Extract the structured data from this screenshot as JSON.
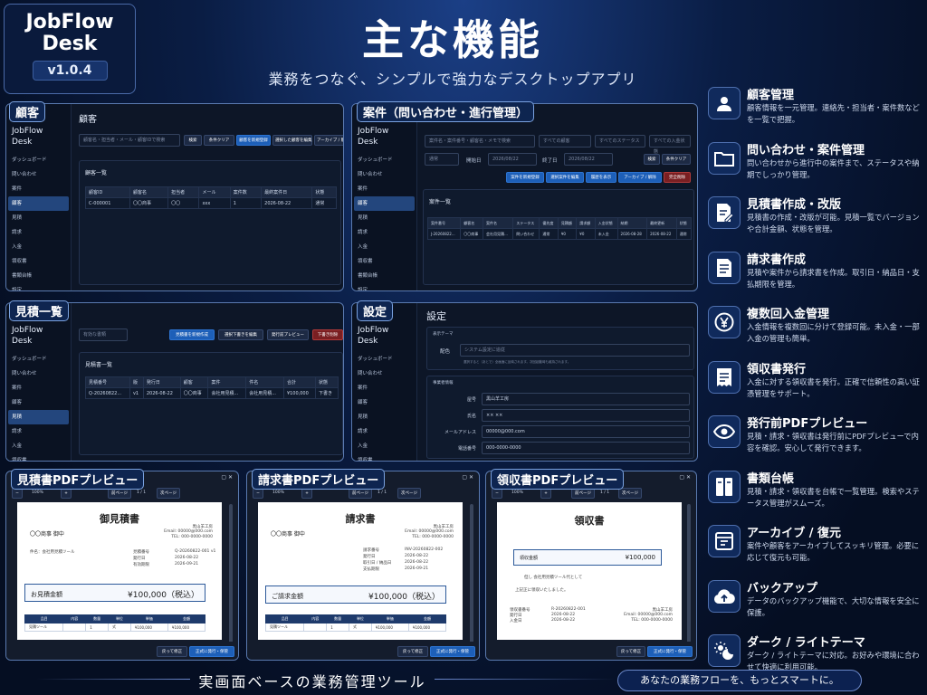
{
  "brand": {
    "name_line1": "JobFlow",
    "name_line2": "Desk",
    "version": "v1.0.4"
  },
  "header": {
    "title": "主な機能",
    "subtitle": "業務をつなぐ、シンプルで強力なデスクトップアプリ"
  },
  "app": {
    "name": "JobFlow Desk"
  },
  "w1": {
    "tag": "顧客",
    "heading": "顧客",
    "search_placeholder": "顧客名・担当者・メール・顧客IDで検索",
    "btns": [
      "検索",
      "条件クリア",
      "顧客を新規登録",
      "選択した顧客を編集",
      "アーカイブ / 削除"
    ],
    "list_title": "顧客一覧",
    "headers": [
      "顧客ID",
      "顧客名",
      "担当者",
      "メール",
      "案件数",
      "最終案件日",
      "状態"
    ],
    "row": [
      "C-000001",
      "〇〇商事",
      "〇〇",
      "xxx",
      "1",
      "2026-08-22",
      "通常"
    ],
    "side": [
      "ダッシュボード",
      "問い合わせ",
      "案件",
      "顧客",
      "見積",
      "請求",
      "入金",
      "領収書",
      "書類台帳",
      "設定"
    ]
  },
  "w2": {
    "tag": "案件（問い合わせ・進行管理）",
    "search_placeholder": "案件名・案件番号・顧客名・メモで検索",
    "selects": [
      "すべての顧客",
      "すべてのステータス",
      "すべての入金状態"
    ],
    "sort": "通常",
    "start_label": "開始日",
    "start_date": "2026/08/22",
    "end_label": "終了日",
    "end_date": "2026/08/22",
    "btn_search": "検索",
    "btn_clear": "条件クリア",
    "btns": [
      "案件を新規登録",
      "選択案件を編集",
      "履歴を表示",
      "アーカイブ / 解除",
      "完全削除"
    ],
    "list_title": "案件一覧",
    "headers": [
      "案件番号",
      "顧客名",
      "案件名",
      "ステータス",
      "優先度",
      "見積額",
      "請求額",
      "入金状態",
      "納期",
      "最終更新",
      "状態"
    ],
    "row": [
      "J-20260822...",
      "〇〇商事",
      "会社用見積...",
      "問い合わせ",
      "通常",
      "¥0",
      "¥0",
      "未入金",
      "2026-08-28",
      "2026-08-22",
      "通常"
    ],
    "side": [
      "ダッシュボード",
      "問い合わせ",
      "案件",
      "顧客",
      "見積",
      "請求",
      "入金",
      "領収書",
      "書類台帳",
      "設定"
    ]
  },
  "w3": {
    "tag": "見積一覧",
    "filter": "有効な書類",
    "btns": [
      "見積書を新規作成",
      "選択下書きを編集",
      "発行前プレビュー",
      "下書き削除"
    ],
    "list_title": "見積書一覧",
    "headers": [
      "見積番号",
      "版",
      "発行日",
      "顧客",
      "案件",
      "件名",
      "合計",
      "状態"
    ],
    "row": [
      "Q-20260822...",
      "v1",
      "2026-08-22",
      "〇〇商事",
      "会社用見積...",
      "会社用見積...",
      "¥100,000",
      "下書き"
    ],
    "side": [
      "ダッシュボード",
      "問い合わせ",
      "案件",
      "顧客",
      "見積",
      "請求",
      "入金",
      "領収書"
    ]
  },
  "w4": {
    "tag": "設定",
    "heading": "設定",
    "sec1": "表示テーマ",
    "color_label": "配色",
    "color_value": "システム設定に追従",
    "note": "選択すると（あとで）全画面に反映されます。次回起動時も維持されます。",
    "sec2": "事業者情報",
    "fields": [
      {
        "label": "屋号",
        "value": "黒山羊工房"
      },
      {
        "label": "氏名",
        "value": "×× ××"
      },
      {
        "label": "メールアドレス",
        "value": "00000@000.com"
      },
      {
        "label": "電話番号",
        "value": "000-0000-0000"
      }
    ],
    "side": [
      "ダッシュボード",
      "問い合わせ",
      "案件",
      "顧客",
      "見積",
      "請求",
      "入金",
      "領収書",
      "書類台帳",
      "設定"
    ]
  },
  "pv1": {
    "tag": "見積書PDFプレビュー",
    "zoom": "100%",
    "prev": "前ページ",
    "page": "1 / 1",
    "next": "次ページ",
    "doc_title": "御見積書",
    "to": "〇〇商事 御中",
    "subject": "件名：会社用見積ツール",
    "company": "黒山羊工房",
    "email": "Email: 00000@000.com",
    "tel": "TEL: 000-0000-0000",
    "meta": [
      [
        "見積番号",
        "Q-20260822-001 v1"
      ],
      [
        "発行日",
        "2026-08-22"
      ],
      [
        "有効期限",
        "2026-09-21"
      ]
    ],
    "total_label": "お見積金額",
    "total": "¥100,000（税込）",
    "th": [
      "品目",
      "内容",
      "数量",
      "単位",
      "単価",
      "金額"
    ],
    "tr": [
      "見積ツール",
      "",
      "1",
      "式",
      "¥100,000",
      "¥100,000"
    ],
    "b1": "戻って修正",
    "b2": "正式に発行・保管"
  },
  "pv2": {
    "tag": "請求書PDFプレビュー",
    "zoom": "100%",
    "prev": "前ページ",
    "page": "1 / 1",
    "next": "次ページ",
    "doc_title": "請求書",
    "to": "〇〇商事 御中",
    "company": "黒山羊工房",
    "email": "Email: 00000@000.com",
    "tel": "TEL: 000-0000-0000",
    "meta": [
      [
        "請求番号",
        "INV-20260822-002"
      ],
      [
        "発行日",
        "2026-08-22"
      ],
      [
        "取引日 / 納品日",
        "2026-08-22"
      ],
      [
        "支払期限",
        "2026-09-21"
      ]
    ],
    "total_label": "ご請求金額",
    "total": "¥100,000（税込）",
    "th": [
      "品目",
      "内容",
      "数量",
      "単位",
      "単価",
      "金額"
    ],
    "tr": [
      "見積ツール",
      "",
      "1",
      "式",
      "¥100,000",
      "¥100,000"
    ],
    "b1": "戻って修正",
    "b2": "正式に発行・保管"
  },
  "pv3": {
    "tag": "領収書PDFプレビュー",
    "zoom": "100%",
    "prev": "前ページ",
    "page": "1 / 1",
    "next": "次ページ",
    "doc_title": "領収書",
    "amount_label": "領収金額",
    "amount": "¥100,000",
    "note1": "但し 会社用見積ツール代として",
    "note2": "上記正に領収いたしました。",
    "meta": [
      [
        "領収書番号",
        "R-20260822-001"
      ],
      [
        "発行日",
        "2026-08-22"
      ],
      [
        "入金日",
        "2026-08-22"
      ]
    ],
    "company": "黒山羊工房",
    "email": "Email: 00000@000.com",
    "tel": "TEL: 000-0000-0000",
    "b1": "戻って修正",
    "b2": "正式に発行・保管"
  },
  "features": [
    {
      "icon": "person-icon",
      "title": "顧客管理",
      "desc": "顧客情報を一元管理。連絡先・担当者・案件数などを一覧で把握。"
    },
    {
      "icon": "folder-icon",
      "title": "問い合わせ・案件管理",
      "desc": "問い合わせから進行中の案件まで、ステータスや納期でしっかり管理。"
    },
    {
      "icon": "edit-document-icon",
      "title": "見積書作成・改版",
      "desc": "見積書の作成・改版が可能。見積一覧でバージョンや合計金額、状態を管理。"
    },
    {
      "icon": "invoice-icon",
      "title": "請求書作成",
      "desc": "見積や案件から請求書を作成。取引日・納品日・支払期限を管理。"
    },
    {
      "icon": "yen-icon",
      "title": "複数回入金管理",
      "desc": "入金情報を複数回に分けて登録可能。未入金・一部入金の管理も簡単。"
    },
    {
      "icon": "receipt-icon",
      "title": "領収書発行",
      "desc": "入金に対する領収書を発行。正確で信頼性の高い証憑管理をサポート。"
    },
    {
      "icon": "eye-icon",
      "title": "発行前PDFプレビュー",
      "desc": "見積・請求・領収書は発行前にPDFプレビューで内容を確認。安心して発行できます。"
    },
    {
      "icon": "binder-icon",
      "title": "書類台帳",
      "desc": "見積・請求・領収書を台帳で一覧管理。検索やステータス管理がスムーズ。"
    },
    {
      "icon": "archive-icon",
      "title": "アーカイブ / 復元",
      "desc": "案件や顧客をアーカイブしてスッキリ管理。必要に応じて復元も可能。"
    },
    {
      "icon": "cloud-upload-icon",
      "title": "バックアップ",
      "desc": "データのバックアップ機能で、大切な情報を安全に保護。"
    },
    {
      "icon": "theme-icon",
      "title": "ダーク / ライトテーマ",
      "desc": "ダーク / ライトテーマに対応。お好みや環境に合わせて快適に利用可能。"
    }
  ],
  "footer": {
    "text": "実画面ベースの業務管理ツール",
    "pill": "あなたの業務フローを、もっとスマートに。"
  }
}
